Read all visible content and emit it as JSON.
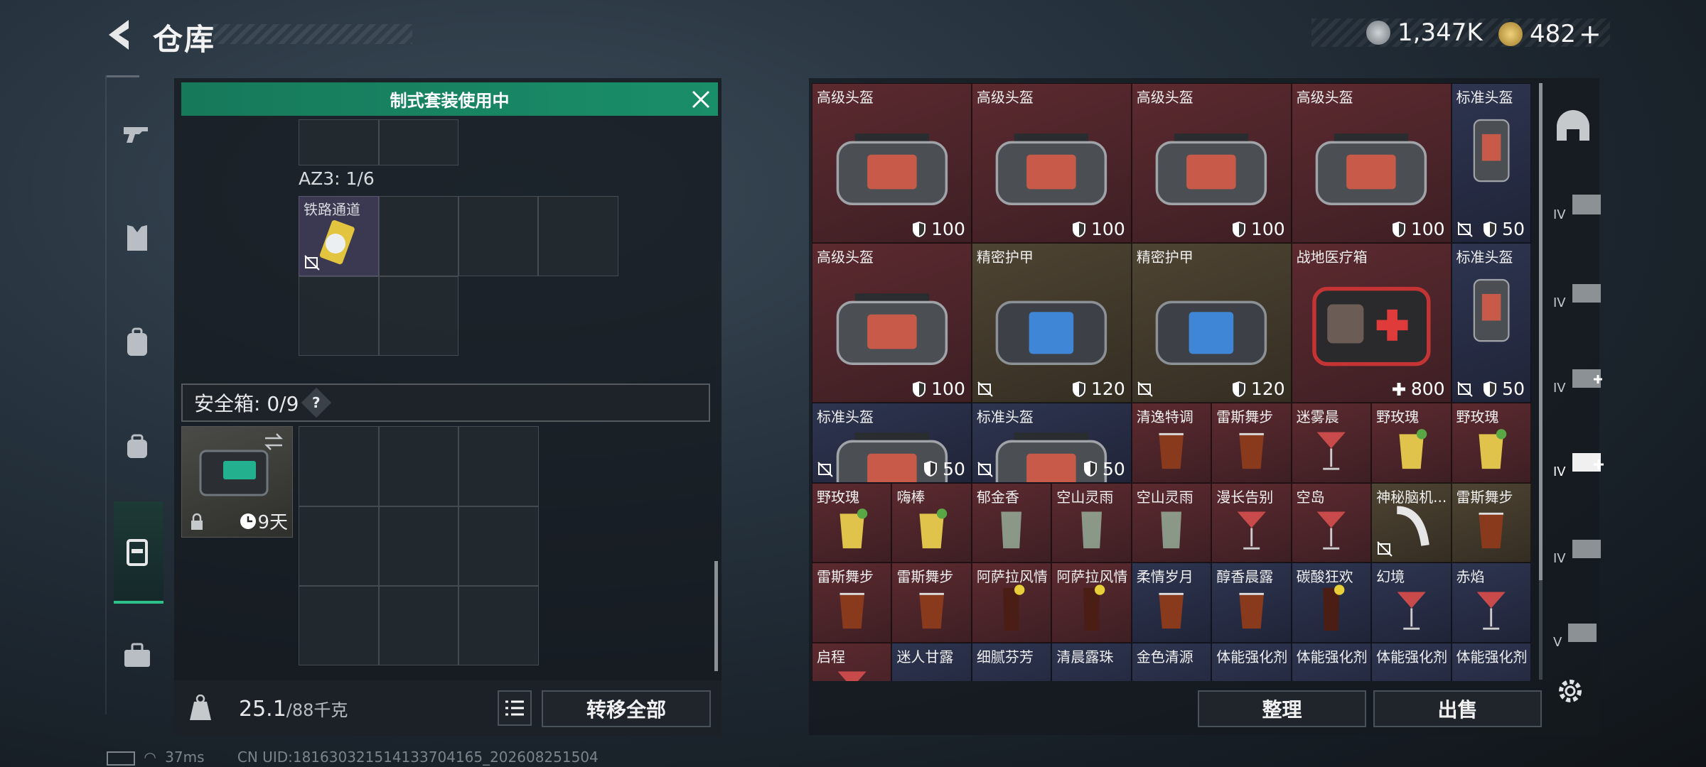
{
  "header": {
    "title": "仓库",
    "currency1": "1,347K",
    "currency2": "482",
    "currency2_plus": "+"
  },
  "left": {
    "banner": "制式套装使用中",
    "az3_label": "AZ3: 1/6",
    "az3_item_name": "铁路通道",
    "safebox_label": "安全箱: 0/9",
    "safebox_help": "?",
    "safebox_days": "9天",
    "weight_current": "25.1",
    "weight_max": "/88千克",
    "transfer_all": "转移全部"
  },
  "right": {
    "tiles": [
      {
        "name": "高级头盔",
        "val": "100",
        "icon": "shield-icon",
        "kind": "bag",
        "color": "red",
        "nodis": false
      },
      {
        "name": "高级头盔",
        "val": "100",
        "icon": "shield-icon",
        "kind": "bag",
        "color": "red",
        "nodis": false
      },
      {
        "name": "高级头盔",
        "val": "100",
        "icon": "shield-icon",
        "kind": "bag",
        "color": "red",
        "nodis": false
      },
      {
        "name": "高级头盔",
        "val": "100",
        "icon": "shield-icon",
        "kind": "bag",
        "color": "red",
        "nodis": false
      },
      {
        "name": "标准头盔",
        "val": "50",
        "icon": "shield-icon",
        "kind": "bag-small",
        "color": "blue",
        "nodis": true
      },
      {
        "name": "高级头盔",
        "val": "100",
        "icon": "shield-icon",
        "kind": "bag",
        "color": "red",
        "nodis": false
      },
      {
        "name": "精密护甲",
        "val": "120",
        "icon": "shield-icon",
        "kind": "armor",
        "color": "gold",
        "nodis": true
      },
      {
        "name": "精密护甲",
        "val": "120",
        "icon": "shield-icon",
        "kind": "armor",
        "color": "gold",
        "nodis": true
      },
      {
        "name": "战地医疗箱",
        "val": "800",
        "icon": "plus-icon",
        "kind": "medkit",
        "color": "red",
        "nodis": false
      },
      {
        "name": "标准头盔",
        "val": "50",
        "icon": "shield-icon",
        "kind": "bag-small",
        "color": "blue",
        "nodis": true
      },
      {
        "name": "标准头盔",
        "val": "50",
        "icon": "shield-icon",
        "kind": "bag",
        "color": "blue",
        "nodis": true
      },
      {
        "name": "标准头盔",
        "val": "50",
        "icon": "shield-icon",
        "kind": "bag",
        "color": "blue",
        "nodis": true
      },
      {
        "name": "清逸特调",
        "val": "",
        "kind": "drink",
        "color": "red",
        "nodis": false
      },
      {
        "name": "雷斯舞步",
        "val": "",
        "kind": "drink",
        "color": "red",
        "nodis": false
      },
      {
        "name": "迷雾晨",
        "val": "",
        "kind": "cocktail",
        "color": "red",
        "nodis": false
      },
      {
        "name": "野玫瑰",
        "val": "",
        "kind": "drink-y",
        "color": "red",
        "nodis": false
      },
      {
        "name": "野玫瑰",
        "val": "",
        "kind": "drink-y",
        "color": "red",
        "nodis": false
      },
      {
        "name": "野玫瑰",
        "val": "",
        "kind": "drink-y",
        "color": "red",
        "nodis": false
      },
      {
        "name": "嗨棒",
        "val": "",
        "kind": "drink-y",
        "color": "red",
        "nodis": false
      },
      {
        "name": "郁金香",
        "val": "",
        "kind": "glass",
        "color": "red",
        "nodis": false
      },
      {
        "name": "空山灵雨",
        "val": "",
        "kind": "glass",
        "color": "red",
        "nodis": false
      },
      {
        "name": "空山灵雨",
        "val": "",
        "kind": "glass",
        "color": "red",
        "nodis": false
      },
      {
        "name": "漫长告别",
        "val": "",
        "kind": "cocktail",
        "color": "red",
        "nodis": false
      },
      {
        "name": "空岛",
        "val": "",
        "kind": "cocktail",
        "color": "red",
        "nodis": false
      },
      {
        "name": "神秘脑机...",
        "val": "",
        "kind": "device",
        "color": "gold",
        "nodis": true
      },
      {
        "name": "雷斯舞步",
        "val": "",
        "kind": "drink",
        "color": "gold",
        "nodis": false
      },
      {
        "name": "雷斯舞步",
        "val": "",
        "kind": "drink",
        "color": "red",
        "nodis": false
      },
      {
        "name": "雷斯舞步",
        "val": "",
        "kind": "drink",
        "color": "red",
        "nodis": false
      },
      {
        "name": "阿萨拉风情",
        "val": "",
        "kind": "tall",
        "color": "red",
        "nodis": false
      },
      {
        "name": "阿萨拉风情",
        "val": "",
        "kind": "tall",
        "color": "red",
        "nodis": false
      },
      {
        "name": "柔情岁月",
        "val": "",
        "kind": "drink",
        "color": "blue",
        "nodis": false
      },
      {
        "name": "醇香晨露",
        "val": "",
        "kind": "drink",
        "color": "blue",
        "nodis": false
      },
      {
        "name": "碳酸狂欢",
        "val": "",
        "kind": "tall",
        "color": "blue",
        "nodis": false
      },
      {
        "name": "幻境",
        "val": "",
        "kind": "cocktail",
        "color": "blue",
        "nodis": false
      },
      {
        "name": "赤焰",
        "val": "",
        "kind": "cocktail",
        "color": "blue",
        "nodis": false
      },
      {
        "name": "启程",
        "val": "",
        "kind": "cocktail",
        "color": "red",
        "nodis": false
      },
      {
        "name": "迷人甘露",
        "val": "",
        "kind": "none",
        "color": "blue",
        "nodis": false
      },
      {
        "name": "细腻芬芳",
        "val": "",
        "kind": "none",
        "color": "blue",
        "nodis": false
      },
      {
        "name": "清晨露珠",
        "val": "",
        "kind": "none",
        "color": "blue",
        "nodis": false
      },
      {
        "name": "金色清源",
        "val": "",
        "kind": "none",
        "color": "blue",
        "nodis": false
      },
      {
        "name": "体能强化剂",
        "val": "",
        "kind": "none",
        "color": "blue",
        "nodis": false
      },
      {
        "name": "体能强化剂",
        "val": "",
        "kind": "none",
        "color": "blue",
        "nodis": false
      },
      {
        "name": "体能强化剂",
        "val": "",
        "kind": "none",
        "color": "blue",
        "nodis": false
      },
      {
        "name": "体能强化剂",
        "val": "",
        "kind": "none",
        "color": "blue",
        "nodis": false
      }
    ],
    "sort_button": "整理",
    "sell_button": "出售",
    "side_labels": [
      "IV",
      "IV",
      "IV",
      "IV",
      "IV",
      "V"
    ]
  },
  "status": {
    "ping": "37ms",
    "uid": "CN UID:1816303215141337041​65_202608251504"
  },
  "colors": {
    "accent": "#1a8e69",
    "red_tile": "#5c2a2f",
    "blue_tile": "#2e3550",
    "gold_tile": "#4e4433"
  }
}
